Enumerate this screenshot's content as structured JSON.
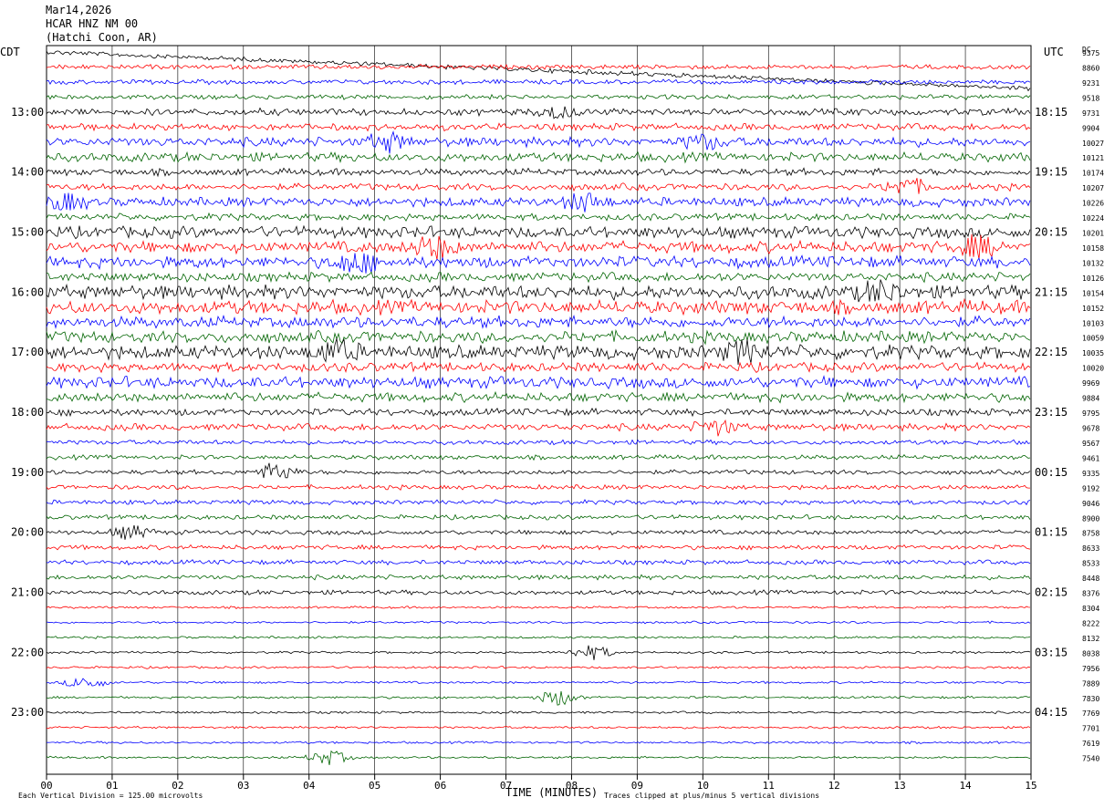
{
  "header": {
    "date": "Mar14,2026",
    "station": "HCAR HNZ NM 00",
    "location": "(Hatchi Coon, AR)"
  },
  "left_axis_title": "CDT",
  "right_axis_title": "UTC",
  "dc_label": "DC",
  "x_axis_title": "TIME (MINUTES)",
  "footer": {
    "scale_note": "Each Vertical Division =  125.00 microvolts",
    "clip_note": "Traces clipped at plus/minus 5 vertical divisions"
  },
  "chart_data": {
    "type": "line",
    "title": "HCAR HNZ NM 00",
    "xlabel": "TIME (MINUTES)",
    "xlim": [
      0,
      15
    ],
    "x_ticks": [
      "00",
      "01",
      "02",
      "03",
      "04",
      "05",
      "06",
      "07",
      "08",
      "09",
      "10",
      "11",
      "12",
      "13",
      "14",
      "15"
    ],
    "trace_colors": [
      "#000000",
      "#ff0000",
      "#0000ff",
      "#006400"
    ],
    "left_time_labels": [
      "13:00",
      "14:00",
      "15:00",
      "16:00",
      "17:00",
      "18:00",
      "19:00",
      "20:00",
      "21:00",
      "22:00",
      "23:00"
    ],
    "right_time_labels": [
      "18:15",
      "19:15",
      "20:15",
      "21:15",
      "22:15",
      "23:15",
      "00:15",
      "01:15",
      "02:15",
      "03:15",
      "04:15"
    ],
    "dc_offsets": [
      "9375",
      "8860",
      "9231",
      "9518",
      "9731",
      "9904",
      "10027",
      "10121",
      "10174",
      "10207",
      "10226",
      "10224",
      "10201",
      "10158",
      "10132",
      "10126",
      "10154",
      "10152",
      "10103",
      "10059",
      "10035",
      "10020",
      "9969",
      "9884",
      "9795",
      "9678",
      "9567",
      "9461",
      "9335",
      "9192",
      "9046",
      "8900",
      "8758",
      "8633",
      "8533",
      "8448",
      "8376",
      "8304",
      "8222",
      "8132",
      "8038",
      "7956",
      "7889",
      "7830",
      "7769",
      "7701",
      "7619",
      "7540"
    ],
    "noise_level": [
      2,
      2,
      2,
      2,
      3,
      3,
      4,
      4,
      3,
      3,
      4,
      3,
      5,
      5,
      5,
      4,
      6,
      6,
      5,
      5,
      6,
      4,
      5,
      4,
      3,
      3,
      2,
      2,
      2,
      2,
      2,
      2,
      2,
      2,
      2,
      2,
      2,
      1,
      1,
      1,
      1,
      1,
      1,
      1,
      1,
      1,
      1,
      1
    ],
    "events": [
      {
        "trace": 4,
        "minute": 7.8,
        "amp": 6
      },
      {
        "trace": 6,
        "minute": 5.2,
        "amp": 9
      },
      {
        "trace": 6,
        "minute": 10.0,
        "amp": 7
      },
      {
        "trace": 9,
        "minute": 13.1,
        "amp": 9
      },
      {
        "trace": 10,
        "minute": 0.3,
        "amp": 8
      },
      {
        "trace": 10,
        "minute": 8.2,
        "amp": 9
      },
      {
        "trace": 13,
        "minute": 5.9,
        "amp": 12
      },
      {
        "trace": 13,
        "minute": 14.2,
        "amp": 10
      },
      {
        "trace": 14,
        "minute": 4.7,
        "amp": 11
      },
      {
        "trace": 16,
        "minute": 12.7,
        "amp": 10
      },
      {
        "trace": 20,
        "minute": 4.4,
        "amp": 12
      },
      {
        "trace": 20,
        "minute": 10.6,
        "amp": 11
      },
      {
        "trace": 25,
        "minute": 10.2,
        "amp": 8
      },
      {
        "trace": 28,
        "minute": 3.5,
        "amp": 10
      },
      {
        "trace": 32,
        "minute": 1.3,
        "amp": 7
      },
      {
        "trace": 40,
        "minute": 8.3,
        "amp": 8
      },
      {
        "trace": 42,
        "minute": 0.6,
        "amp": 7
      },
      {
        "trace": 43,
        "minute": 7.8,
        "amp": 9
      },
      {
        "trace": 47,
        "minute": 4.3,
        "amp": 8
      }
    ]
  }
}
